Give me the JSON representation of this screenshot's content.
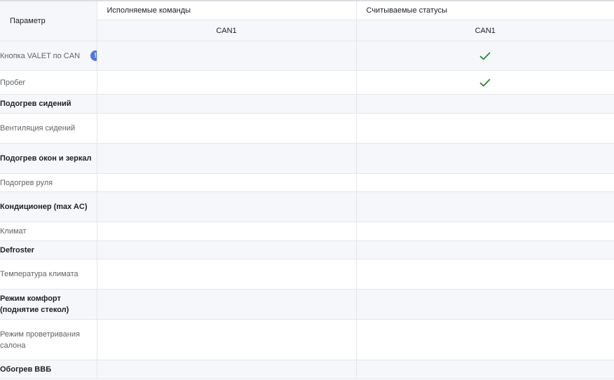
{
  "header": {
    "param_label": "Параметр",
    "commands_label": "Исполняемые команды",
    "statuses_label": "Считываемые статусы",
    "commands_sub": "CAN1",
    "statuses_sub": "CAN1"
  },
  "colors": {
    "band": "#f6f7fb",
    "check": "#2e7d32",
    "info_icon": "#4f72e3"
  },
  "rows": [
    {
      "label": "Кнопка VALET по CAN",
      "bold": false,
      "info_icon": true,
      "command": false,
      "status": true
    },
    {
      "label": "Пробег",
      "bold": false,
      "info_icon": false,
      "command": false,
      "status": true
    },
    {
      "label": "Подогрев сидений",
      "bold": true,
      "info_icon": false,
      "command": false,
      "status": false
    },
    {
      "label": "Вентиляция сидений",
      "bold": false,
      "info_icon": false,
      "command": false,
      "status": false
    },
    {
      "label": "Подогрев окон и зеркал",
      "bold": true,
      "info_icon": false,
      "command": false,
      "status": false
    },
    {
      "label": "Подогрев руля",
      "bold": false,
      "info_icon": false,
      "command": false,
      "status": false
    },
    {
      "label": "Кондиционер (max AC)",
      "bold": true,
      "info_icon": false,
      "command": false,
      "status": false
    },
    {
      "label": "Климат",
      "bold": false,
      "info_icon": false,
      "command": false,
      "status": false
    },
    {
      "label": "Defroster",
      "bold": true,
      "info_icon": false,
      "command": false,
      "status": false
    },
    {
      "label": "Температура климата",
      "bold": false,
      "info_icon": false,
      "command": false,
      "status": false
    },
    {
      "label": "Режим комфорт (поднятие стекол)",
      "bold": true,
      "info_icon": false,
      "command": false,
      "status": false
    },
    {
      "label": "Режим проветривания салона",
      "bold": false,
      "info_icon": false,
      "command": false,
      "status": false
    },
    {
      "label": "Обогрев ВВБ",
      "bold": true,
      "info_icon": false,
      "command": false,
      "status": false
    }
  ]
}
